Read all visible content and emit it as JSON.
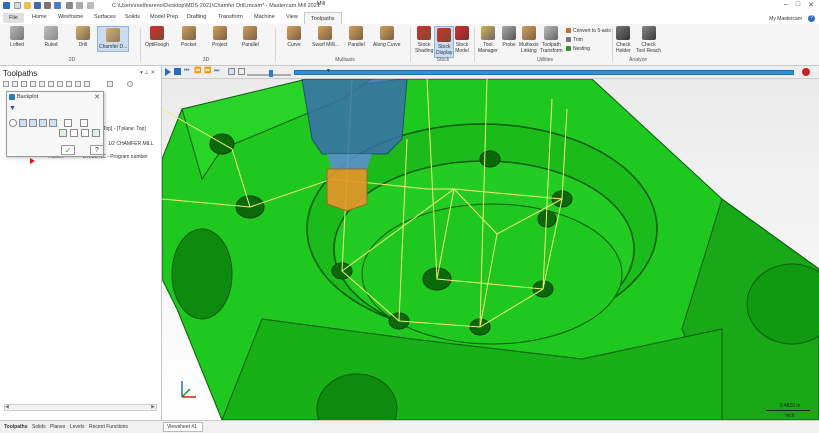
{
  "app": {
    "window_title": "C:\\Users\\reelfeareno\\Desktop\\MDS 2021\\Chamfer Drill.mcam* - Mastercam Mill 2021",
    "context_tab": "Mill",
    "user": "My Mastercam"
  },
  "colors": {
    "accent": "#2a7ac8",
    "part_green": "#1ec81e",
    "tool_blue": "#3a6fae",
    "tool_orange": "#e8952a",
    "path_yellow": "#f0f070",
    "stop_red": "#c82020"
  },
  "tabs": [
    {
      "label": "File"
    },
    {
      "label": "Home"
    },
    {
      "label": "Wireframe"
    },
    {
      "label": "Surfaces"
    },
    {
      "label": "Solids"
    },
    {
      "label": "Model Prep"
    },
    {
      "label": "Drafting"
    },
    {
      "label": "Transform"
    },
    {
      "label": "Machine"
    },
    {
      "label": "View"
    },
    {
      "label": "Toolpaths"
    }
  ],
  "ribbon": {
    "groups": {
      "g2d": "2D",
      "g3d": "3D",
      "multiaxis": "Multiaxis",
      "stock": "Stock",
      "utilities": "Utilities",
      "analyze": "Analyze"
    },
    "buttons": {
      "lofted": "Lofted",
      "ruled": "Ruled",
      "drill": "Drill",
      "chamfer": "Chamfer D...",
      "optirough": "OptiRough",
      "pocket": "Pocket",
      "project": "Project",
      "parallel3d": "Parallel",
      "curve": "Curve",
      "swarf": "Swarf Milli...",
      "parallel_ma": "Parallel",
      "along_curve": "Along Curve",
      "stock_shading_1": "Stock",
      "stock_shading_2": "Shading",
      "stock_display_1": "Stock",
      "stock_display_2": "Display",
      "stock_model_1": "Stock",
      "stock_model_2": "Model",
      "tool_manager_1": "Tool",
      "tool_manager_2": "Manager",
      "probe": "Probe",
      "multiaxis_linking_1": "Multiaxis",
      "multiaxis_linking_2": "Linking",
      "toolpath_transform_1": "Toolpath",
      "toolpath_transform_2": "Transform",
      "convert": "Convert to 5-axis",
      "trim": "Trim",
      "nesting": "Nesting",
      "check_holder_1": "Check",
      "check_holder_2": "Holder",
      "check_reach_1": "Check",
      "check_reach_2": "Tool Reach"
    }
  },
  "panel": {
    "title": "Toolpaths",
    "pin_close": "▾ ⊥ ✕",
    "tree": {
      "row1": "Top] - [Tplane: Top]",
      "row2": "1/2 CHAMFER MILL",
      "row3_label": "Hasset",
      "row3_file": "DRILL.NC - Program number"
    }
  },
  "backplot": {
    "title": "Backplot",
    "ok": "✓",
    "help": "?"
  },
  "viewport": {
    "scale_value": "0.4820 in",
    "scale_unit": "Inch",
    "progress_percent": 100
  },
  "bottom_tabs": {
    "toolpaths": "Toolpaths",
    "solids": "Solids",
    "planes": "Planes",
    "levels": "Levels",
    "recent": "Recent Functions",
    "viewsheet": "Viewsheet #1"
  }
}
